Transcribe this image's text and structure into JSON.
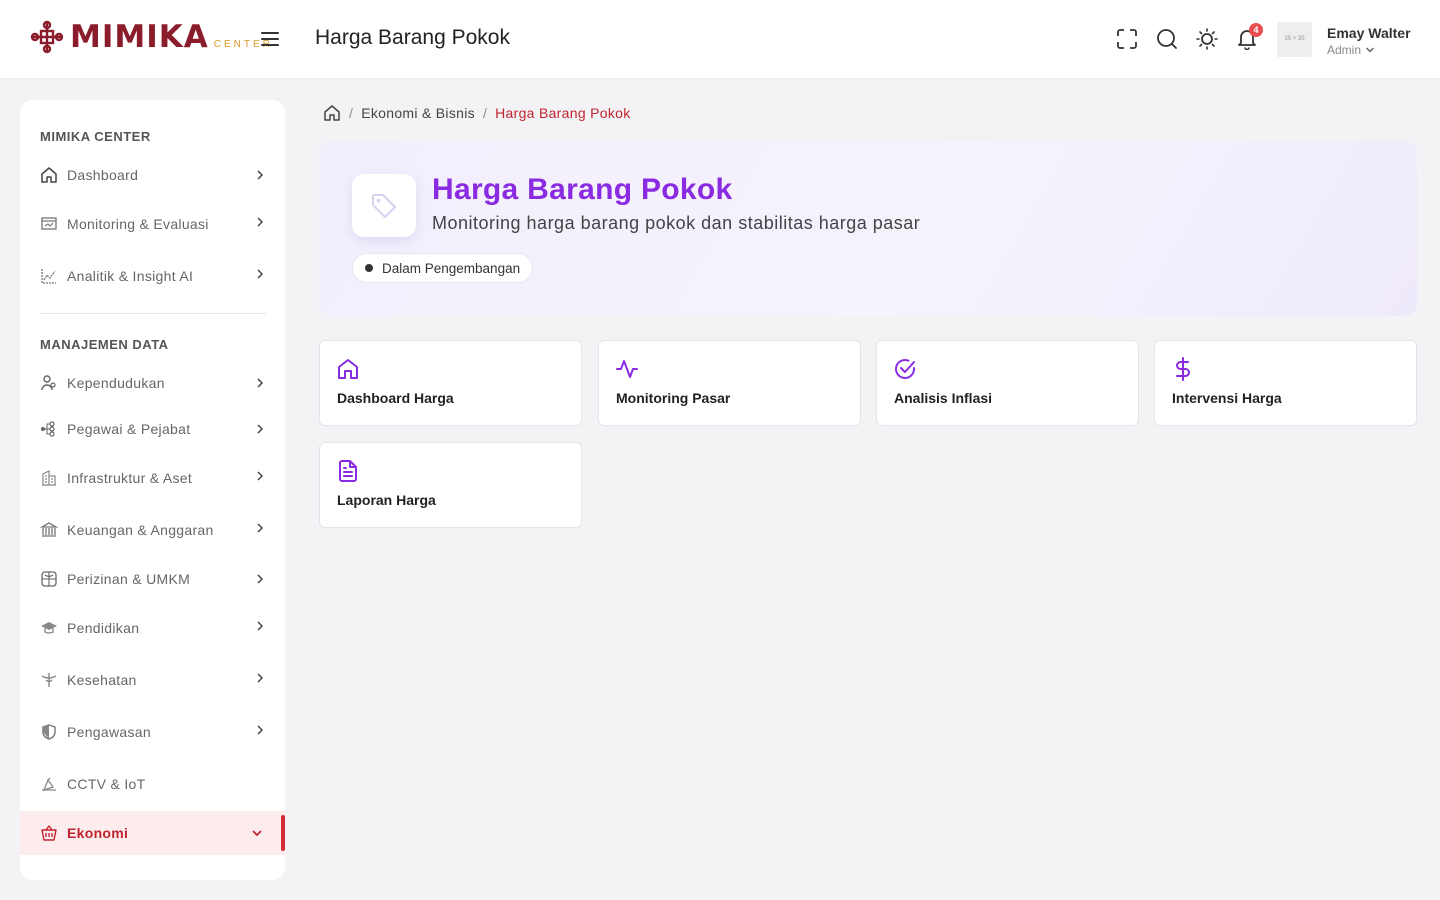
{
  "header": {
    "logo_text": "MIMIKA",
    "logo_sub": "CENTER",
    "page_title": "Harga Barang Pokok",
    "notification_count": "4",
    "avatar_placeholder": "35 × 35",
    "user_name": "Emay Walter",
    "user_role": "Admin",
    "icons": [
      "fullscreen-icon",
      "search-icon",
      "theme-toggle-icon",
      "bell-icon"
    ]
  },
  "sidebar": {
    "section1": "MIMIKA CENTER",
    "section2": "MANAJEMEN DATA",
    "items": [
      {
        "label": "Dashboard",
        "icon": "home-icon"
      },
      {
        "label": "Monitoring & Evaluasi",
        "icon": "monitor-icon"
      },
      {
        "label": "Analitik & Insight AI",
        "icon": "chart-icon"
      },
      {
        "label": "Kependudukan",
        "icon": "users-icon"
      },
      {
        "label": "Pegawai & Pejabat",
        "icon": "org-icon"
      },
      {
        "label": "Infrastruktur & Aset",
        "icon": "building-icon"
      },
      {
        "label": "Keuangan & Anggaran",
        "icon": "bank-icon"
      },
      {
        "label": "Perizinan & UMKM",
        "icon": "globe-icon"
      },
      {
        "label": "Pendidikan",
        "icon": "graduation-cap-icon"
      },
      {
        "label": "Kesehatan",
        "icon": "caduceus-icon"
      },
      {
        "label": "Pengawasan",
        "icon": "shield-icon"
      },
      {
        "label": "CCTV & IoT",
        "icon": "cctv-icon"
      },
      {
        "label": "Ekonomi",
        "icon": "basket-icon",
        "active": true
      }
    ]
  },
  "breadcrumb": {
    "parent": "Ekonomi & Bisnis",
    "current": "Harga Barang Pokok"
  },
  "hero": {
    "title": "Harga Barang Pokok",
    "subtitle": "Monitoring harga barang pokok dan stabilitas harga pasar",
    "badge": "Dalam Pengembangan"
  },
  "cards": [
    {
      "label": "Dashboard Harga",
      "icon": "home-icon"
    },
    {
      "label": "Monitoring Pasar",
      "icon": "activity-icon"
    },
    {
      "label": "Analisis Inflasi",
      "icon": "check-circle-icon"
    },
    {
      "label": "Intervensi Harga",
      "icon": "dollar-icon"
    },
    {
      "label": "Laporan Harga",
      "icon": "file-text-icon"
    }
  ],
  "colors": {
    "brand": "#8a1c2b",
    "accent_purple": "#8a2be2",
    "active_red": "#c0242f"
  }
}
